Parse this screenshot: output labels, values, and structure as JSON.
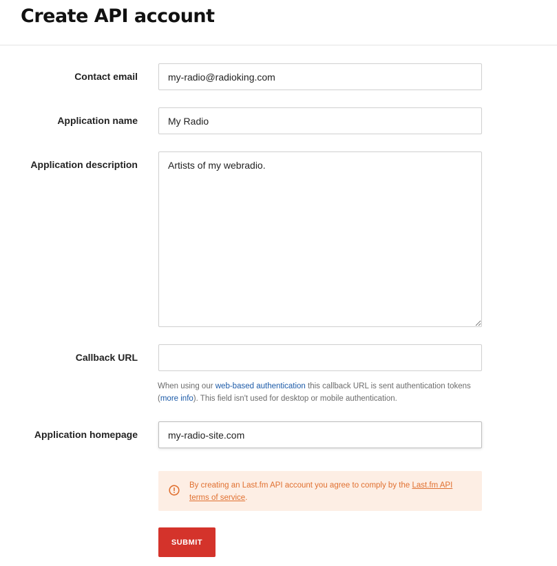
{
  "page": {
    "title": "Create API account"
  },
  "form": {
    "contact_email": {
      "label": "Contact email",
      "value": "my-radio@radioking.com"
    },
    "application_name": {
      "label": "Application name",
      "value": "My Radio"
    },
    "application_description": {
      "label": "Application description",
      "value": "Artists of my webradio."
    },
    "callback_url": {
      "label": "Callback URL",
      "value": "",
      "help_prefix": "When using our ",
      "help_link_auth": "web-based authentication",
      "help_middle": " this callback URL is sent authentication tokens (",
      "help_link_more": "more info",
      "help_suffix": "). This field isn't used for desktop or mobile authentication."
    },
    "application_homepage": {
      "label": "Application homepage",
      "value": "my-radio-site.com"
    },
    "notice": {
      "icon": "alert-circle-icon",
      "text_prefix": "By creating an Last.fm API account you agree to comply by the ",
      "link": "Last.fm API terms of service",
      "text_suffix": "."
    },
    "submit_label": "SUBMIT"
  },
  "colors": {
    "accent": "#d4332b",
    "notice_bg": "#fdeee4",
    "notice_text": "#e07030",
    "link": "#1b5aa8"
  }
}
